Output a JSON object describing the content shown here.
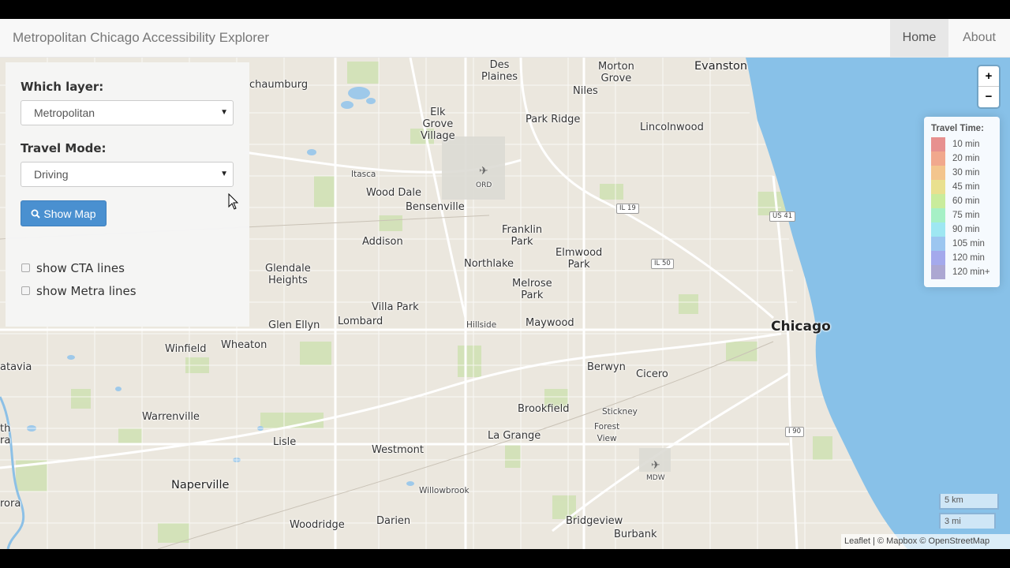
{
  "navbar": {
    "brand": "Metropolitan Chicago Accessibility Explorer",
    "home": "Home",
    "about": "About"
  },
  "panel": {
    "layer_label": "Which layer:",
    "layer_value": "Metropolitan",
    "mode_label": "Travel Mode:",
    "mode_value": "Driving",
    "show_map_button": "Show Map",
    "cta_label": "show CTA lines",
    "metra_label": "show Metra lines"
  },
  "zoom": {
    "in": "+",
    "out": "−"
  },
  "legend": {
    "title": "Travel Time:",
    "items": [
      {
        "label": "10 min",
        "color": "#e7908f"
      },
      {
        "label": "20 min",
        "color": "#f1a88d"
      },
      {
        "label": "30 min",
        "color": "#f3c58d"
      },
      {
        "label": "45 min",
        "color": "#e9e08f"
      },
      {
        "label": "60 min",
        "color": "#c9ec9c"
      },
      {
        "label": "75 min",
        "color": "#a6f0c6"
      },
      {
        "label": "90 min",
        "color": "#9ee7f2"
      },
      {
        "label": "105 min",
        "color": "#9cc6f0"
      },
      {
        "label": "120 min",
        "color": "#a4a9ec"
      },
      {
        "label": "120 min+",
        "color": "#aca7d2"
      }
    ]
  },
  "scale": {
    "km": "5 km",
    "mi": "3 mi"
  },
  "attribution": "Leaflet | © Mapbox © OpenStreetMap",
  "places": {
    "des_plaines": "Des\nPlaines",
    "morton_grove": "Morton\nGrove",
    "evanston": "Evanston",
    "schaumburg": "chaumburg",
    "niles": "Niles",
    "elk_grove": "Elk\nGrove\nVillage",
    "park_ridge": "Park Ridge",
    "lincolnwood": "Lincolnwood",
    "itasca": "Itasca",
    "ord": "ORD",
    "wood_dale": "Wood Dale",
    "bensenville": "Bensenville",
    "franklin_park": "Franklin\nPark",
    "addison": "Addison",
    "elmwood_park": "Elmwood\nPark",
    "northlake": "Northlake",
    "glendale_heights": "Glendale\nHeights",
    "melrose_park": "Melrose\nPark",
    "villa_park": "Villa Park",
    "lombard": "Lombard",
    "hillside": "Hillside",
    "maywood": "Maywood",
    "glen_ellyn": "Glen Ellyn",
    "chicago": "Chicago",
    "winfield": "Winfield",
    "wheaton": "Wheaton",
    "batavia": "atavia",
    "berwyn": "Berwyn",
    "cicero": "Cicero",
    "warrenville": "Warrenville",
    "brookfield": "Brookfield",
    "stickney": "Stickney",
    "forest_view": "Forest\nView",
    "north": "th\nra",
    "lisle": "Lisle",
    "la_grange": "La Grange",
    "westmont": "Westmont",
    "mdw": "MDW",
    "naperville": "Naperville",
    "willowbrook": "Willowbrook",
    "aurora": "rora",
    "darien": "Darien",
    "woodridge": "Woodridge",
    "bridgeview": "Bridgeview",
    "burbank": "Burbank"
  },
  "shields": {
    "il19": "IL 19",
    "us41": "US 41",
    "il50": "IL 50",
    "i90": "I 90"
  }
}
